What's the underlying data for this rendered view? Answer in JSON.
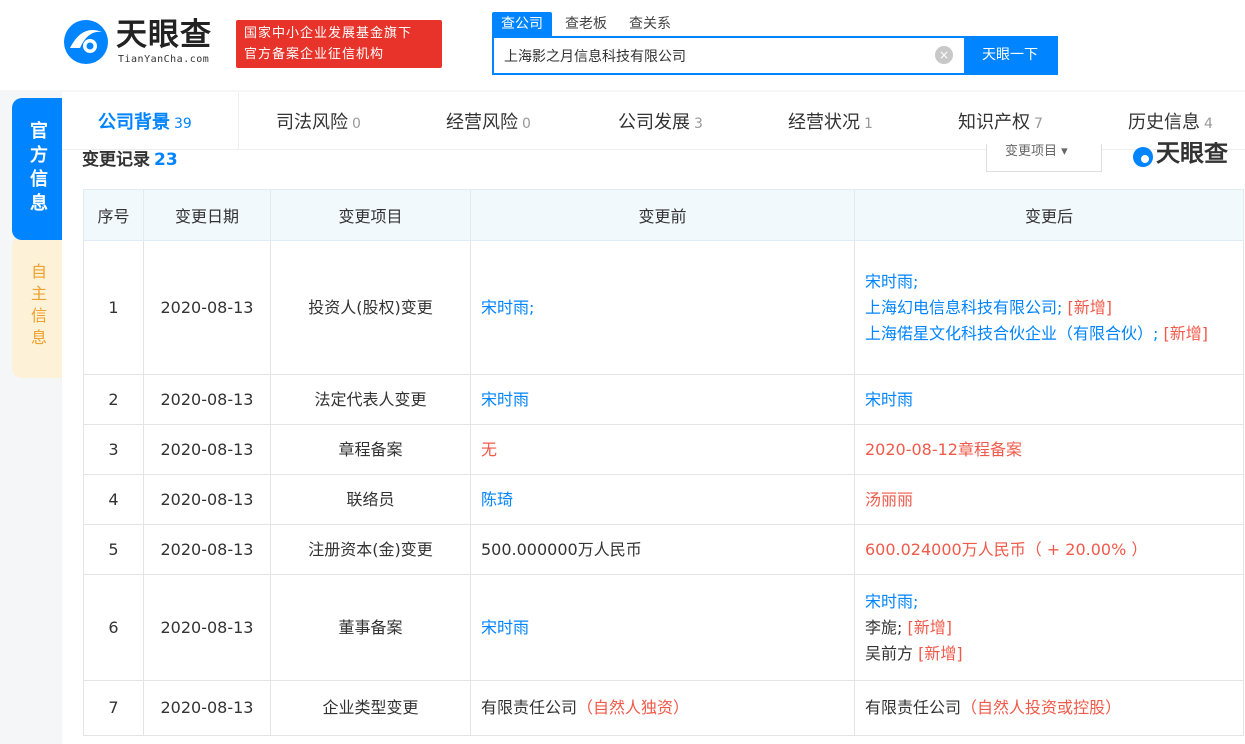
{
  "header": {
    "logo_name": "天眼查",
    "logo_url": "TianYanCha.com",
    "badge_line1": "国家中小企业发展基金旗下",
    "badge_line2": "官方备案企业征信机构",
    "search_tabs": [
      "查公司",
      "查老板",
      "查关系"
    ],
    "search_value": "上海影之月信息科技有限公司",
    "clear_icon": "×",
    "search_button": "天眼一下"
  },
  "side_tabs": {
    "official": "官方信息",
    "self": "自主信息"
  },
  "nav": [
    {
      "label": "公司背景",
      "count": "39"
    },
    {
      "label": "司法风险",
      "count": "0"
    },
    {
      "label": "经营风险",
      "count": "0"
    },
    {
      "label": "公司发展",
      "count": "3"
    },
    {
      "label": "经营状况",
      "count": "1"
    },
    {
      "label": "知识产权",
      "count": "7"
    },
    {
      "label": "历史信息",
      "count": "4"
    }
  ],
  "section": {
    "title": "变更记录",
    "count": "23",
    "filter_label": "变更项目 ▾",
    "watermark": "天眼查"
  },
  "table": {
    "headers": [
      "序号",
      "变更日期",
      "变更项目",
      "变更前",
      "变更后"
    ],
    "rows": [
      {
        "no": "1",
        "date": "2020-08-13",
        "item": "投资人(股权)变更",
        "before": [
          {
            "t": "宋时雨;",
            "c": "blue"
          }
        ],
        "after": [
          [
            {
              "t": "宋时雨;",
              "c": "blue"
            }
          ],
          [
            {
              "t": "上海幻电信息科技有限公司;",
              "c": "blue"
            },
            {
              "t": " [新增]",
              "c": "red"
            }
          ],
          [
            {
              "t": "上海偌星文化科技合伙企业（有限合伙）;",
              "c": "blue"
            },
            {
              "t": " [新增]",
              "c": "red"
            }
          ]
        ]
      },
      {
        "no": "2",
        "date": "2020-08-13",
        "item": "法定代表人变更",
        "before": [
          {
            "t": "宋时雨",
            "c": "blue"
          }
        ],
        "after": [
          [
            {
              "t": "宋时雨",
              "c": "blue"
            }
          ]
        ]
      },
      {
        "no": "3",
        "date": "2020-08-13",
        "item": "章程备案",
        "before": [
          {
            "t": "无",
            "c": "red"
          }
        ],
        "after": [
          [
            {
              "t": "2020-08-12章程备案",
              "c": "red"
            }
          ]
        ]
      },
      {
        "no": "4",
        "date": "2020-08-13",
        "item": "联络员",
        "before": [
          {
            "t": "陈琦",
            "c": "blue"
          }
        ],
        "after": [
          [
            {
              "t": "汤丽丽",
              "c": "red"
            }
          ]
        ]
      },
      {
        "no": "5",
        "date": "2020-08-13",
        "item": "注册资本(金)变更",
        "before": [
          {
            "t": "500.000000万人民币",
            "c": ""
          }
        ],
        "after": [
          [
            {
              "t": "600.024000万人民币（ + 20.00% ）",
              "c": "red"
            }
          ]
        ]
      },
      {
        "no": "6",
        "date": "2020-08-13",
        "item": "董事备案",
        "before": [
          {
            "t": "宋时雨",
            "c": "blue"
          }
        ],
        "after": [
          [
            {
              "t": "宋时雨;",
              "c": "blue"
            }
          ],
          [
            {
              "t": "李旎;",
              "c": ""
            },
            {
              "t": " [新增]",
              "c": "red"
            }
          ],
          [
            {
              "t": "吴前方",
              "c": ""
            },
            {
              "t": " [新增]",
              "c": "red"
            }
          ]
        ]
      },
      {
        "no": "7",
        "date": "2020-08-13",
        "item": "企业类型变更",
        "before": [
          {
            "t": "有限责任公司",
            "c": ""
          },
          {
            "t": "（自然人",
            "c": "red"
          },
          {
            "t": "独",
            "c": "red"
          },
          {
            "t": "资）",
            "c": "red"
          }
        ],
        "after": [
          [
            {
              "t": "有限责任公司",
              "c": ""
            },
            {
              "t": "（自然人",
              "c": "red"
            },
            {
              "t": "投资",
              "c": "red"
            },
            {
              "t": "或",
              "c": "red"
            },
            {
              "t": "控股）",
              "c": "red"
            }
          ]
        ]
      }
    ]
  },
  "colors": {
    "accent": "#0084ff",
    "brand_red": "#e8332a",
    "added_red": "#f05a4a",
    "self_tab_bg": "#fdf1d8",
    "self_tab_text": "#f0a02c"
  }
}
